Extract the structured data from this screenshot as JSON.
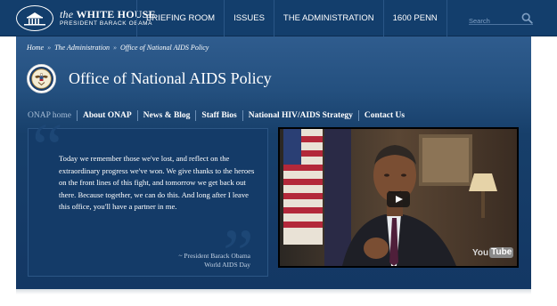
{
  "header": {
    "brand_title_italic": "the",
    "brand_title_main": "WHITE HOUSE",
    "brand_subtitle": "PRESIDENT BARACK OBAMA",
    "nav": [
      "BRIEFING ROOM",
      "ISSUES",
      "THE ADMINISTRATION",
      "1600 PENN"
    ],
    "search_placeholder": "Search"
  },
  "breadcrumb": [
    "Home",
    "The Administration",
    "Office of National AIDS Policy"
  ],
  "breadcrumb_separator": "»",
  "page_title": "Office of National AIDS Policy",
  "subnav": [
    "ONAP home",
    "About ONAP",
    "News & Blog",
    "Staff Bios",
    "National HIV/AIDS Strategy",
    "Contact Us"
  ],
  "quote": {
    "text": "Today we remember those we've lost, and reflect on the extraordinary progress we've won. We give thanks to the heroes on the front lines of this fight, and tomorrow we get back out there. Because together, we can do this. And long after I leave this office, you'll have a partner in me.",
    "attribution": "~ President Barack Obama",
    "occasion": "World AIDS Day",
    "open_mark": "“",
    "close_mark": "”"
  },
  "video": {
    "logo_you": "You",
    "logo_tube": "Tube"
  },
  "colors": {
    "nav_background": "#133e6c",
    "panel_top": "#2f5c8e",
    "panel_bottom": "#133764",
    "quote_background": "#143b68"
  }
}
